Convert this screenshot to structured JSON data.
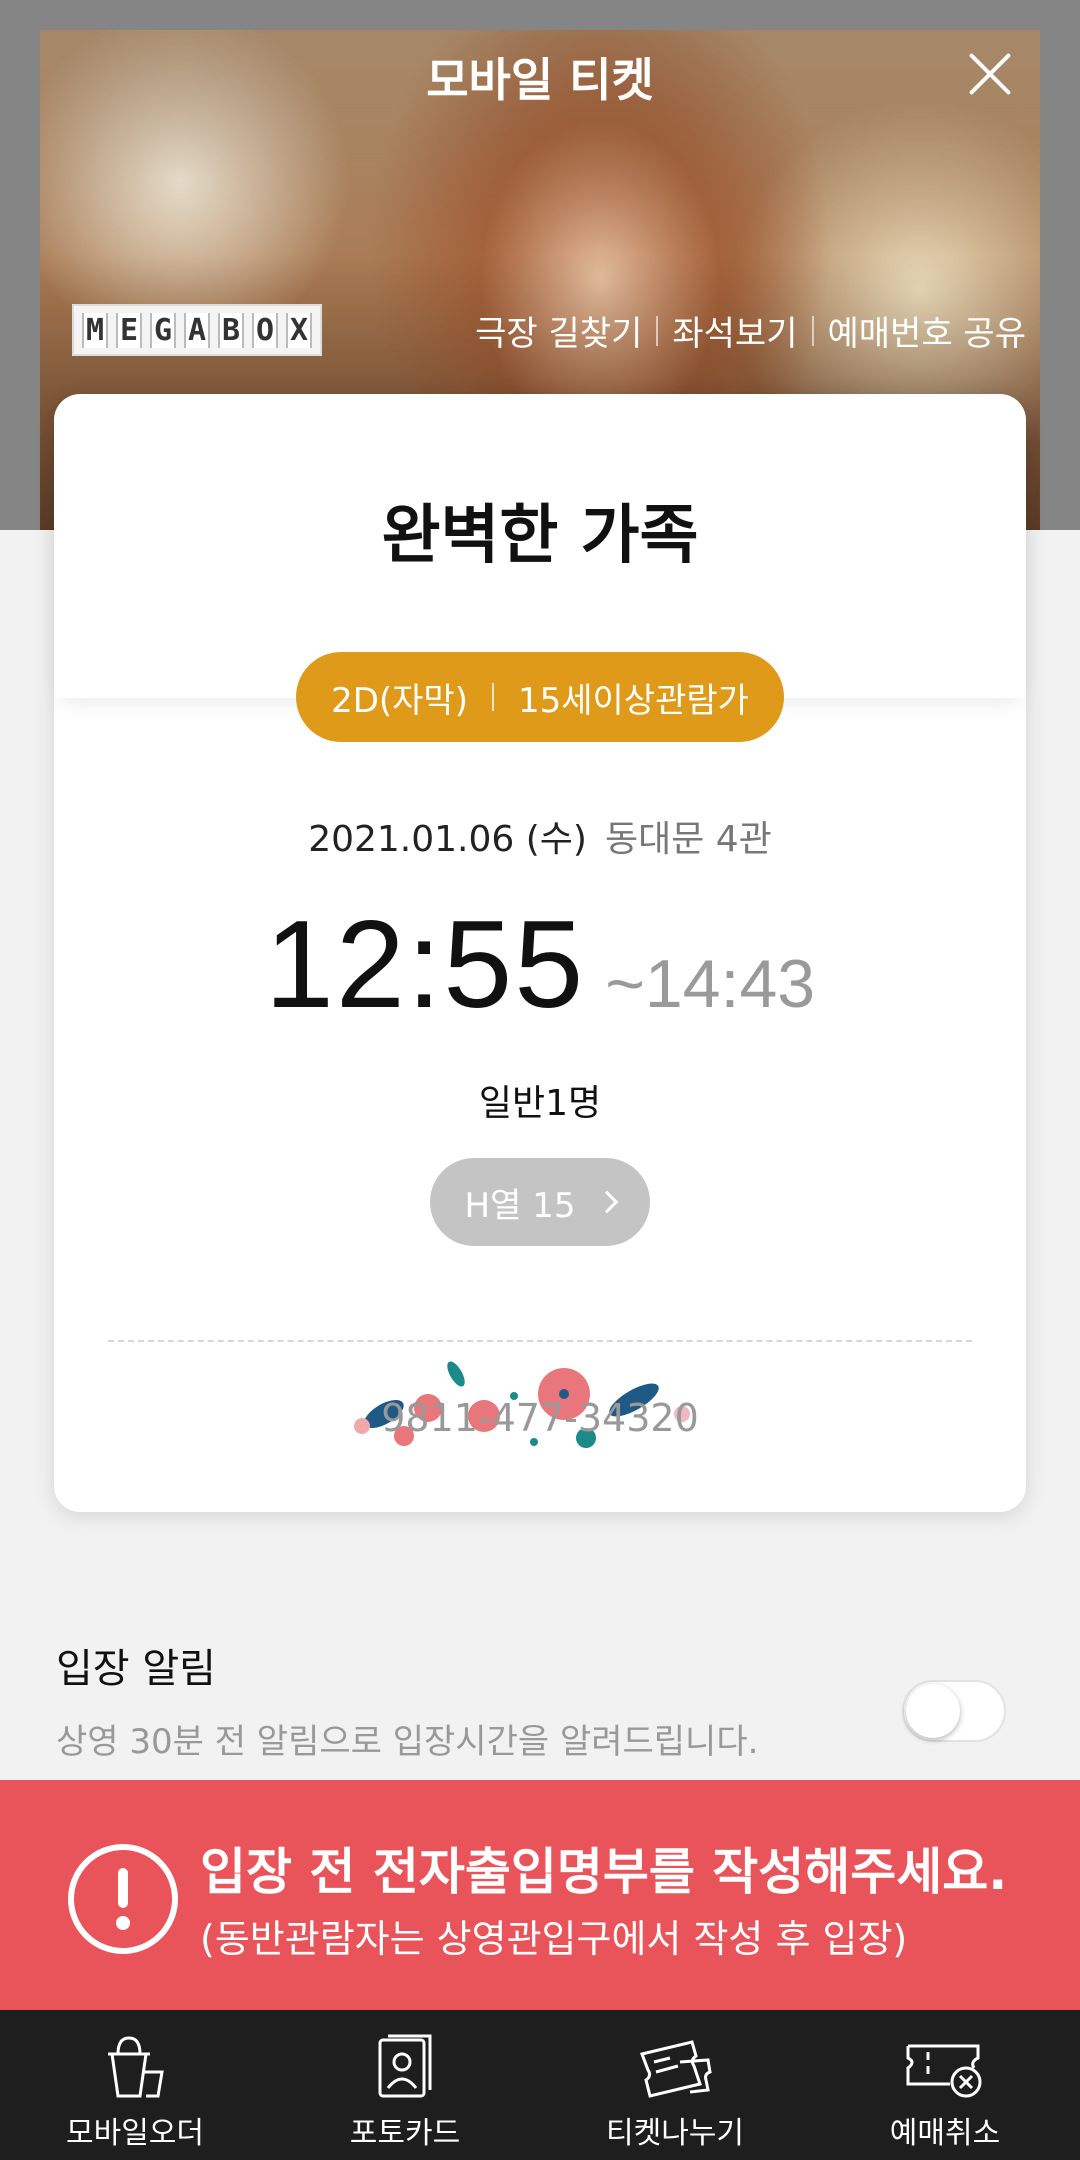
{
  "header": {
    "title": "모바일 티켓",
    "logo_text": "MEGABOX",
    "links": [
      "극장 길찾기",
      "좌석보기",
      "예매번호 공유"
    ]
  },
  "ticket": {
    "movie_title": "완벽한 가족",
    "format": "2D(자막)",
    "rating": "15세이상관람가",
    "date": "2021.01.06 (수)",
    "screen": "동대문 4관",
    "start_time": "12:55",
    "end_time": "~14:43",
    "people": "일반1명",
    "seat": "H열 15",
    "booking_number": "9811-477-34320"
  },
  "entry_alert": {
    "title": "입장 알림",
    "description": "상영 30분 전 알림으로 입장시간을 알려드립니다.",
    "enabled": false
  },
  "banner": {
    "line1": "입장 전 전자출입명부를 작성해주세요.",
    "line2": "(동반관람자는 상영관입구에서 작성 후 입장)"
  },
  "bottom_nav": [
    {
      "label": "모바일오더",
      "icon": "drink-cup-icon"
    },
    {
      "label": "포토카드",
      "icon": "photo-card-icon"
    },
    {
      "label": "티켓나누기",
      "icon": "share-ticket-icon"
    },
    {
      "label": "예매취소",
      "icon": "cancel-ticket-icon"
    }
  ],
  "colors": {
    "pill": "#e09a1a",
    "banner": "#e9545a",
    "nav_bg": "#1e1e1e"
  }
}
